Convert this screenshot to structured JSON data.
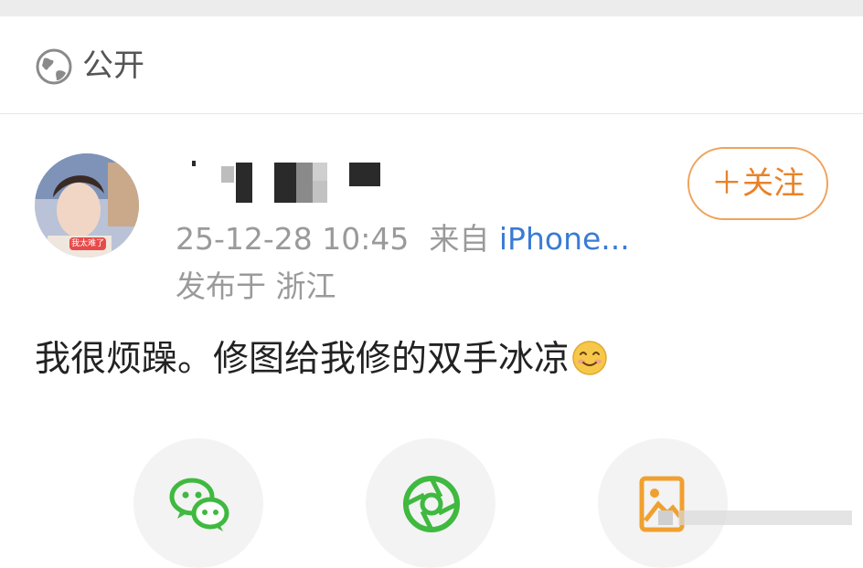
{
  "visibility": {
    "icon": "globe-icon",
    "label": "公开"
  },
  "post": {
    "avatar_badge": "我太难了",
    "timestamp": "25-12-28 10:45",
    "source_prefix": "来自",
    "source_client": "iPhone...",
    "location": "发布于 浙江",
    "text": "我很烦躁。修图给我修的双手冰凉",
    "emoji": "smiling-face-emoji"
  },
  "follow_button": {
    "label": "＋关注"
  },
  "share_options": [
    {
      "name": "wechat",
      "icon": "wechat-icon"
    },
    {
      "name": "moments",
      "icon": "wechat-moments-icon"
    },
    {
      "name": "save-image",
      "icon": "save-image-icon"
    }
  ],
  "colors": {
    "accent_orange": "#e8822a",
    "link_blue": "#3a7bd5",
    "wechat_green": "#3fb93f"
  }
}
